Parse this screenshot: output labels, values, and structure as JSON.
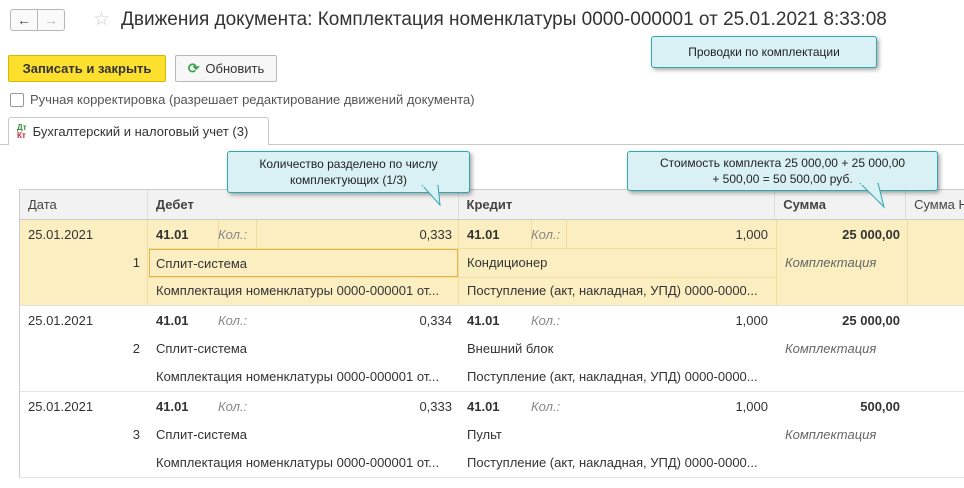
{
  "window": {
    "title": "Движения документа: Комплектация номенклатуры 0000-000001 от 25.01.2021 8:33:08",
    "back_icon": "arrow-left",
    "forward_icon": "arrow-right",
    "favorite_icon": "star"
  },
  "toolbar": {
    "save_close_label": "Записать и закрыть",
    "refresh_label": "Обновить"
  },
  "manual_correction": {
    "label": "Ручная корректировка (разрешает редактирование движений документа)",
    "checked": false
  },
  "tab": {
    "icon_dt": "Дт",
    "icon_kt": "Кт",
    "label": "Бухгалтерский и налоговый учет (3)"
  },
  "table": {
    "headers": {
      "date": "Дата",
      "debet": "Дебет",
      "kredit": "Кредит",
      "summa": "Сумма",
      "summa_n": "Сумма Н"
    },
    "rows": [
      {
        "date": "25.01.2021",
        "num": "1",
        "debet_account": "41.01",
        "debet_kol_label": "Кол.:",
        "debet_qty": "0,333",
        "debet_subconto": "Сплит-система",
        "debet_doc": "Комплектация номенклатуры 0000-000001 от...",
        "kredit_account": "41.01",
        "kredit_kol_label": "Кол.:",
        "kredit_qty": "1,000",
        "kredit_subconto": "Кондиционер",
        "kredit_doc": "Поступление (акт, накладная, УПД) 0000-0000...",
        "summa": "25 000,00",
        "content": "Комплектация"
      },
      {
        "date": "25.01.2021",
        "num": "2",
        "debet_account": "41.01",
        "debet_kol_label": "Кол.:",
        "debet_qty": "0,334",
        "debet_subconto": "Сплит-система",
        "debet_doc": "Комплектация номенклатуры 0000-000001 от...",
        "kredit_account": "41.01",
        "kredit_kol_label": "Кол.:",
        "kredit_qty": "1,000",
        "kredit_subconto": "Внешний блок",
        "kredit_doc": "Поступление (акт, накладная, УПД) 0000-0000...",
        "summa": "25 000,00",
        "content": "Комплектация"
      },
      {
        "date": "25.01.2021",
        "num": "3",
        "debet_account": "41.01",
        "debet_kol_label": "Кол.:",
        "debet_qty": "0,333",
        "debet_subconto": "Сплит-система",
        "debet_doc": "Комплектация номенклатуры 0000-000001 от...",
        "kredit_account": "41.01",
        "kredit_kol_label": "Кол.:",
        "kredit_qty": "1,000",
        "kredit_subconto": "Пульт",
        "kredit_doc": "Поступление (акт, накладная, УПД) 0000-0000...",
        "summa": "500,00",
        "content": "Комплектация"
      }
    ]
  },
  "callouts": {
    "postings": "Проводки по комплектации",
    "quantity_line1": "Количество разделено по числу",
    "quantity_line2": "комплектующих (1/3)",
    "cost_line1": "Стоимость комплекта 25 000,00 + 25 000,00",
    "cost_line2": "+ 500,00 = 50 500,00 руб."
  },
  "colors": {
    "primary_button": "#fde02d",
    "selected_row": "#fbefc2",
    "callout_bg": "#d9f1f4",
    "callout_border": "#2fa7ad"
  }
}
